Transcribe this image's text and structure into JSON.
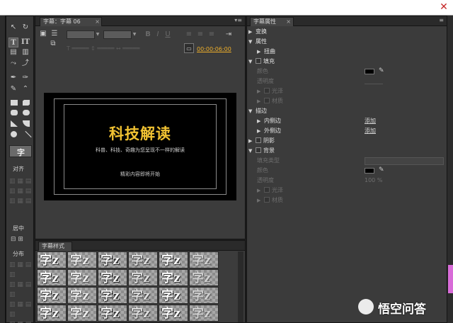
{
  "window": {
    "close_glyph": "✕"
  },
  "tools": {
    "section_align": "对齐",
    "section_center": "居中",
    "section_distribute": "分布",
    "preview_glyph": "字"
  },
  "editor": {
    "tab_label": "字幕：字幕 06",
    "tab_close": "×",
    "menu_glyph": "▾≡",
    "timecode": "00:00:06:00",
    "canvas": {
      "title": "科技解读",
      "subtitle": "科普、科技、奇趣为您呈现不一样的解读",
      "tagline": "精彩内容即将开始",
      "title_color": "#f1c232"
    }
  },
  "styles_panel": {
    "tab_label": "字幕样式",
    "glyph": "字",
    "suffix": "z"
  },
  "properties": {
    "tab_label": "字幕属性",
    "tab_close": "×",
    "transform": "变换",
    "attributes": "属性",
    "distort": "扭曲",
    "fill": "填充",
    "color": "颜色",
    "opacity": "透明度",
    "sheen": "光泽",
    "texture": "材质",
    "stroke": "描边",
    "inner_stroke": "内侧边",
    "outer_stroke": "外侧边",
    "add": "添加",
    "shadow": "阴影",
    "background": "背景",
    "fill_type": "填充类型",
    "bg_color": "颜色",
    "bg_opacity": "透明度",
    "bg_opacity_value": "100 %",
    "bg_sheen": "光泽",
    "bg_texture": "材质"
  },
  "watermark": {
    "text": "悟空问答"
  }
}
